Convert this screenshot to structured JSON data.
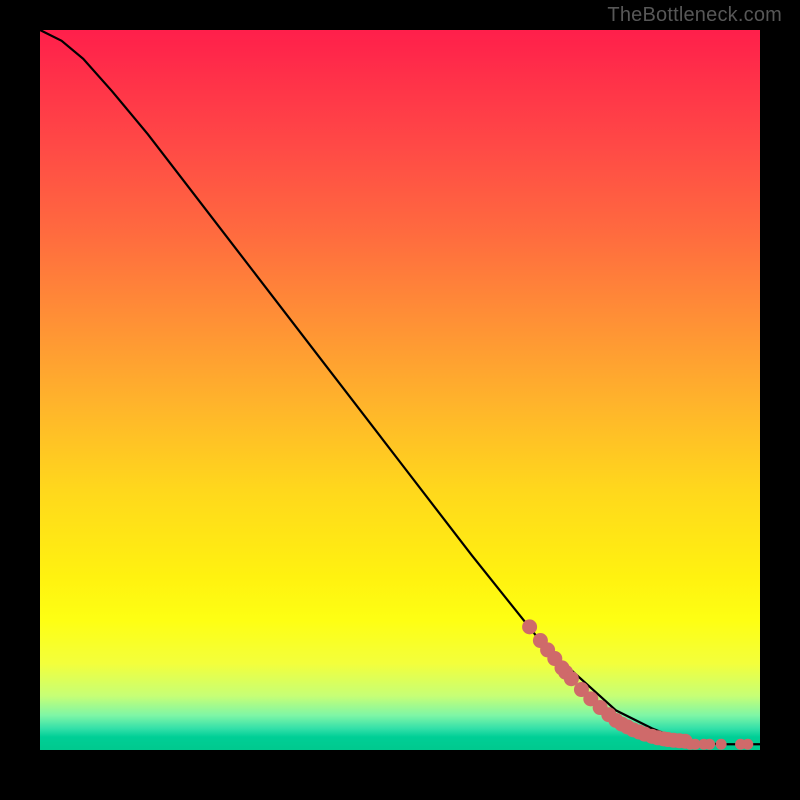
{
  "attribution": "TheBottleneck.com",
  "colors": {
    "frame": "#000000",
    "curve": "#000000",
    "dots": "#cf6a6a",
    "attrib": "#575757"
  },
  "chart_data": {
    "type": "line",
    "title": "",
    "xlabel": "",
    "ylabel": "",
    "xlim": [
      0,
      100
    ],
    "ylim": [
      0,
      100
    ],
    "curve": {
      "name": "bottleneck-curve",
      "x": [
        0,
        3,
        6,
        10,
        15,
        20,
        30,
        40,
        50,
        60,
        70,
        80,
        85,
        88,
        90,
        92,
        95,
        100
      ],
      "y": [
        100,
        98.5,
        96,
        91.5,
        85.5,
        79,
        66,
        53,
        40,
        27,
        14.5,
        5.5,
        3,
        1.8,
        1.2,
        0.9,
        0.8,
        0.8
      ]
    },
    "series": [
      {
        "name": "dots-on-curve",
        "type": "scatter",
        "x": [
          68,
          69.5,
          70.5,
          71.5,
          72.5,
          73,
          73.8,
          75.2,
          76.5,
          77.8,
          79,
          80,
          80.8,
          81.6,
          82.4,
          83.2,
          84,
          85,
          85.8,
          86.6,
          87.2,
          88,
          88.8,
          89.6
        ],
        "y": [
          17.1,
          15.2,
          13.9,
          12.7,
          11.4,
          10.8,
          9.9,
          8.4,
          7.1,
          5.9,
          4.9,
          4.1,
          3.6,
          3.2,
          2.8,
          2.5,
          2.2,
          1.9,
          1.7,
          1.55,
          1.45,
          1.35,
          1.28,
          1.22
        ]
      },
      {
        "name": "dots-flat",
        "type": "scatter",
        "x": [
          90.3,
          91,
          92.2,
          93,
          94.6,
          97.3,
          98.3
        ],
        "y": [
          0.8,
          0.8,
          0.8,
          0.8,
          0.8,
          0.8,
          0.8
        ]
      }
    ]
  }
}
